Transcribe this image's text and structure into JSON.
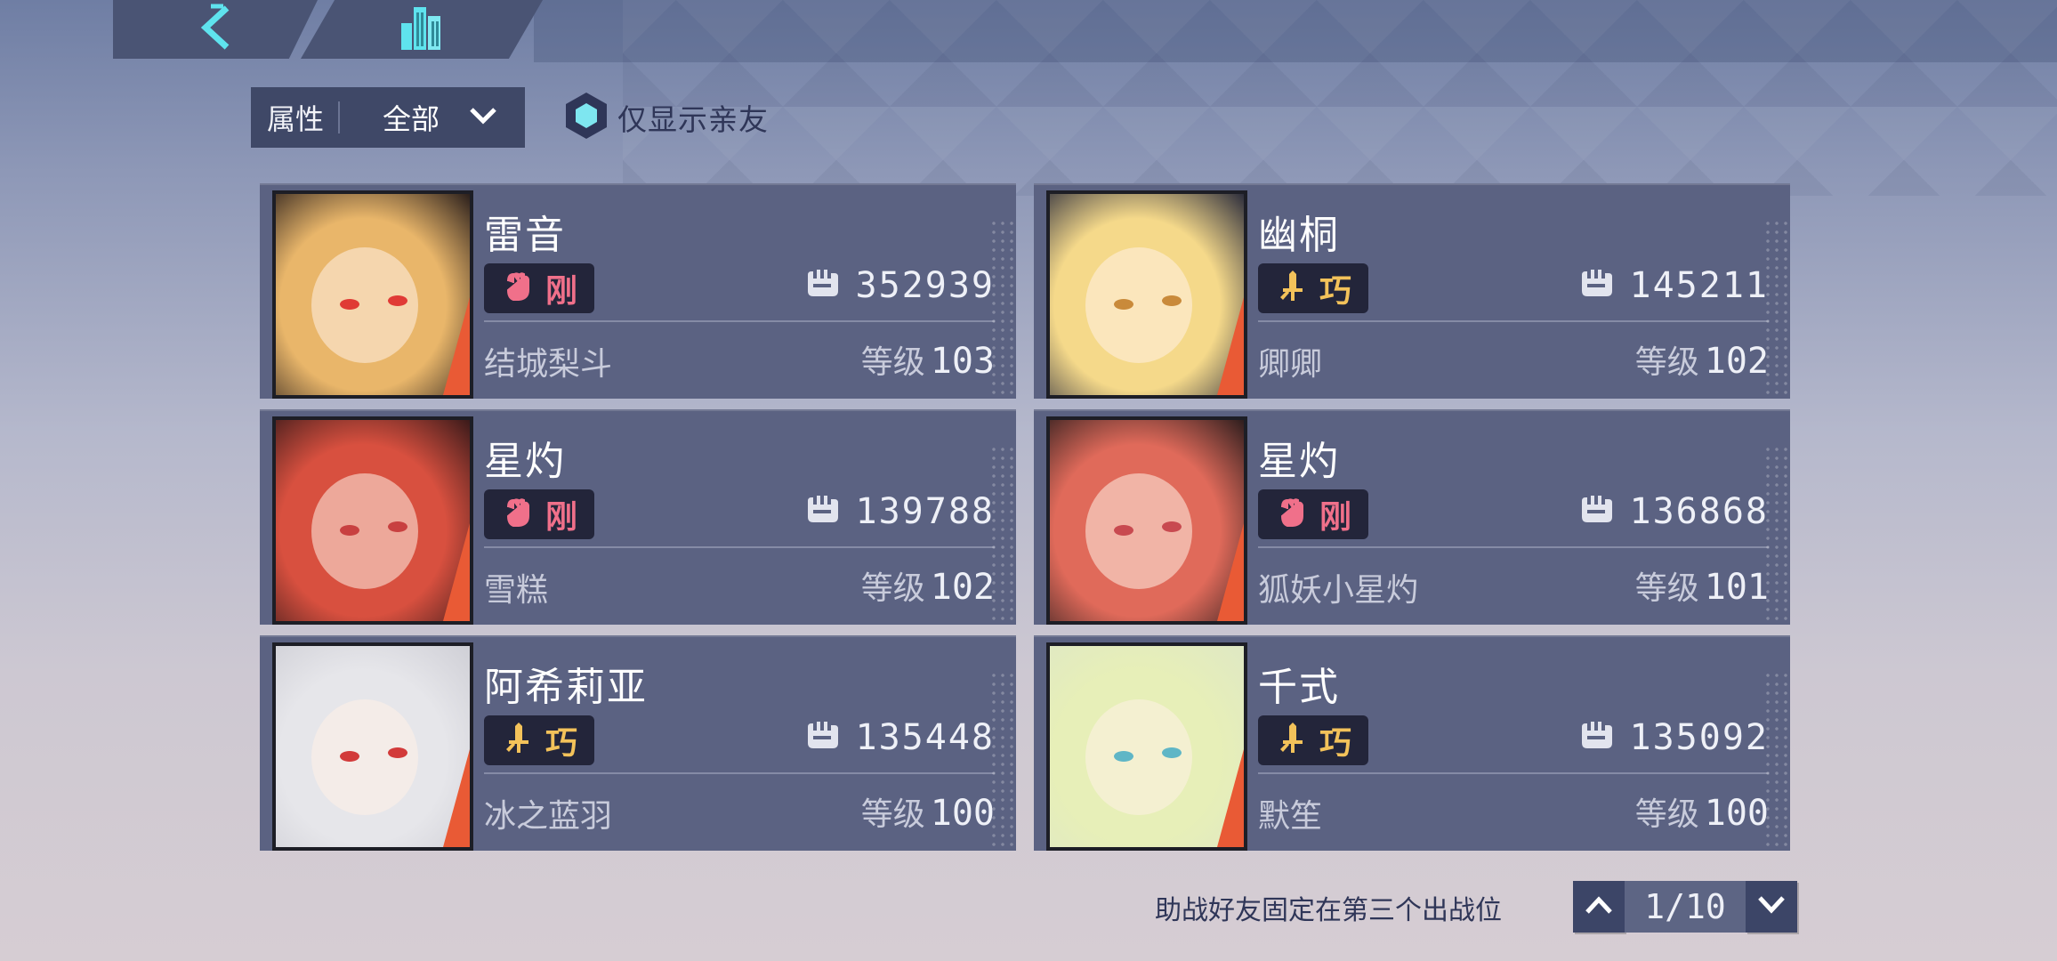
{
  "nav": {
    "back_icon": "chevron-left-icon",
    "city_icon": "city-buildings-icon"
  },
  "filter": {
    "label": "属性",
    "value": "全部"
  },
  "friend_toggle": {
    "label": "仅显示亲友"
  },
  "cards": [
    {
      "name": "雷音",
      "attr": "刚",
      "attr_icon": "fist-icon",
      "power": "352939",
      "owner": "结城梨斗",
      "level_label": "等级",
      "level": "103",
      "colors": {
        "hair": "#e9b66a",
        "bg": "#2a1f1c",
        "eye": "#e03a35"
      }
    },
    {
      "name": "幽桐",
      "attr": "巧",
      "attr_icon": "dagger-icon",
      "power": "145211",
      "owner": "卿卿",
      "level_label": "等级",
      "level": "102",
      "colors": {
        "hair": "#f5d98a",
        "bg": "#2c2d3c",
        "eye": "#c98a3a"
      }
    },
    {
      "name": "星灼",
      "attr": "刚",
      "attr_icon": "fist-icon",
      "power": "139788",
      "owner": "雪糕",
      "level_label": "等级",
      "level": "102",
      "colors": {
        "hair": "#d8503f",
        "bg": "#3a1a1a",
        "eye": "#c84040"
      }
    },
    {
      "name": "星灼",
      "attr": "刚",
      "attr_icon": "fist-icon",
      "power": "136868",
      "owner": "狐妖小星灼",
      "level_label": "等级",
      "level": "101",
      "colors": {
        "hair": "#e06a5a",
        "bg": "#2e1e1e",
        "eye": "#c84a50"
      }
    },
    {
      "name": "阿希莉亚",
      "attr": "巧",
      "attr_icon": "dagger-icon",
      "power": "135448",
      "owner": "冰之蓝羽",
      "level_label": "等级",
      "level": "100",
      "colors": {
        "hair": "#e6e6ea",
        "bg": "#cfcfd6",
        "eye": "#d23a3a"
      }
    },
    {
      "name": "千式",
      "attr": "巧",
      "attr_icon": "dagger-icon",
      "power": "135092",
      "owner": "默笙",
      "level_label": "等级",
      "level": "100",
      "colors": {
        "hair": "#e7efb8",
        "bg": "#dfe8c4",
        "eye": "#5fb6c6"
      }
    }
  ],
  "footer": {
    "note": "助战好友固定在第三个出战位",
    "page": "1/10",
    "up_icon": "chevron-up-icon",
    "down_icon": "chevron-down-icon"
  },
  "theme": {
    "card_bg": "#5b6282",
    "badge_gang": "#f0708a",
    "badge_qiao": "#f3c25a",
    "accent_cyan": "#5fe3ee",
    "portrait_corner": "#e95a35"
  }
}
